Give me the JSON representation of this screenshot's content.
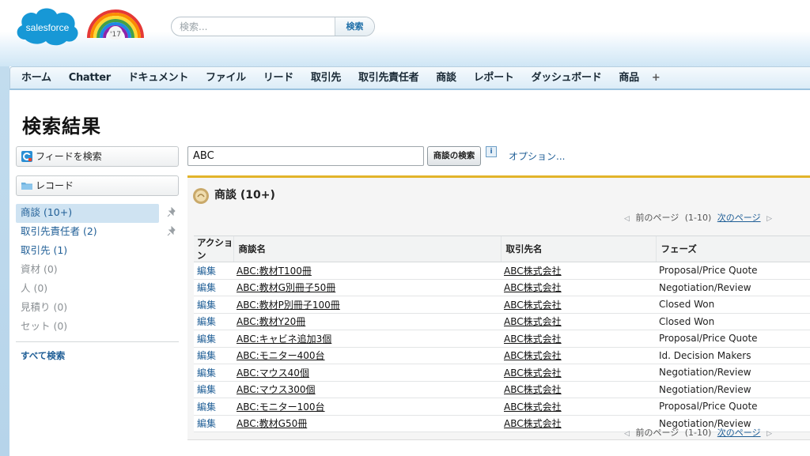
{
  "header": {
    "logo_text": "salesforce",
    "release_badge": "'17",
    "search": {
      "placeholder": "検索...",
      "button_label": "検索"
    }
  },
  "tabs": [
    "ホーム",
    "Chatter",
    "ドキュメント",
    "ファイル",
    "リード",
    "取引先",
    "取引先責任者",
    "商談",
    "レポート",
    "ダッシュボード",
    "商品",
    "+"
  ],
  "page": {
    "title": "検索結果"
  },
  "sidebar": {
    "feed_search_label": "フィードを検索",
    "records_label": "レコード",
    "items": [
      {
        "label": "商談 (10+)",
        "state": "active"
      },
      {
        "label": "取引先責任者 (2)",
        "state": "link"
      },
      {
        "label": "取引先 (1)",
        "state": "link"
      },
      {
        "label": "資材 (0)",
        "state": "muted"
      },
      {
        "label": "人 (0)",
        "state": "muted"
      },
      {
        "label": "見積り (0)",
        "state": "muted"
      },
      {
        "label": "セット (0)",
        "state": "muted"
      }
    ],
    "search_all_label": "すべて検索"
  },
  "main": {
    "search_value": "ABC",
    "search_button_label": "商談の検索",
    "info_label": "i",
    "options_link": "オプション..."
  },
  "results": {
    "title": "商談 (10+)",
    "pager": {
      "prev": "前のページ",
      "range": "(1-10)",
      "next": "次のページ"
    },
    "columns": [
      "アクション",
      "商談名",
      "取引先名",
      "フェーズ"
    ],
    "rows": [
      {
        "action": "編集",
        "name": "ABC:教材T100冊",
        "account": "ABC株式会社",
        "phase": "Proposal/Price Quote"
      },
      {
        "action": "編集",
        "name": "ABC:教材G別冊子50冊",
        "account": "ABC株式会社",
        "phase": "Negotiation/Review"
      },
      {
        "action": "編集",
        "name": "ABC:教材P別冊子100冊",
        "account": "ABC株式会社",
        "phase": "Closed Won"
      },
      {
        "action": "編集",
        "name": "ABC:教材Y20冊",
        "account": "ABC株式会社",
        "phase": "Closed Won"
      },
      {
        "action": "編集",
        "name": "ABC:キャビネ追加3個",
        "account": "ABC株式会社",
        "phase": "Proposal/Price Quote"
      },
      {
        "action": "編集",
        "name": "ABC:モニター400台",
        "account": "ABC株式会社",
        "phase": "Id. Decision Makers"
      },
      {
        "action": "編集",
        "name": "ABC:マウス40個",
        "account": "ABC株式会社",
        "phase": "Negotiation/Review"
      },
      {
        "action": "編集",
        "name": "ABC:マウス300個",
        "account": "ABC株式会社",
        "phase": "Negotiation/Review"
      },
      {
        "action": "編集",
        "name": "ABC:モニター100台",
        "account": "ABC株式会社",
        "phase": "Proposal/Price Quote"
      },
      {
        "action": "編集",
        "name": "ABC:教材G50冊",
        "account": "ABC株式会社",
        "phase": "Negotiation/Review"
      }
    ]
  }
}
